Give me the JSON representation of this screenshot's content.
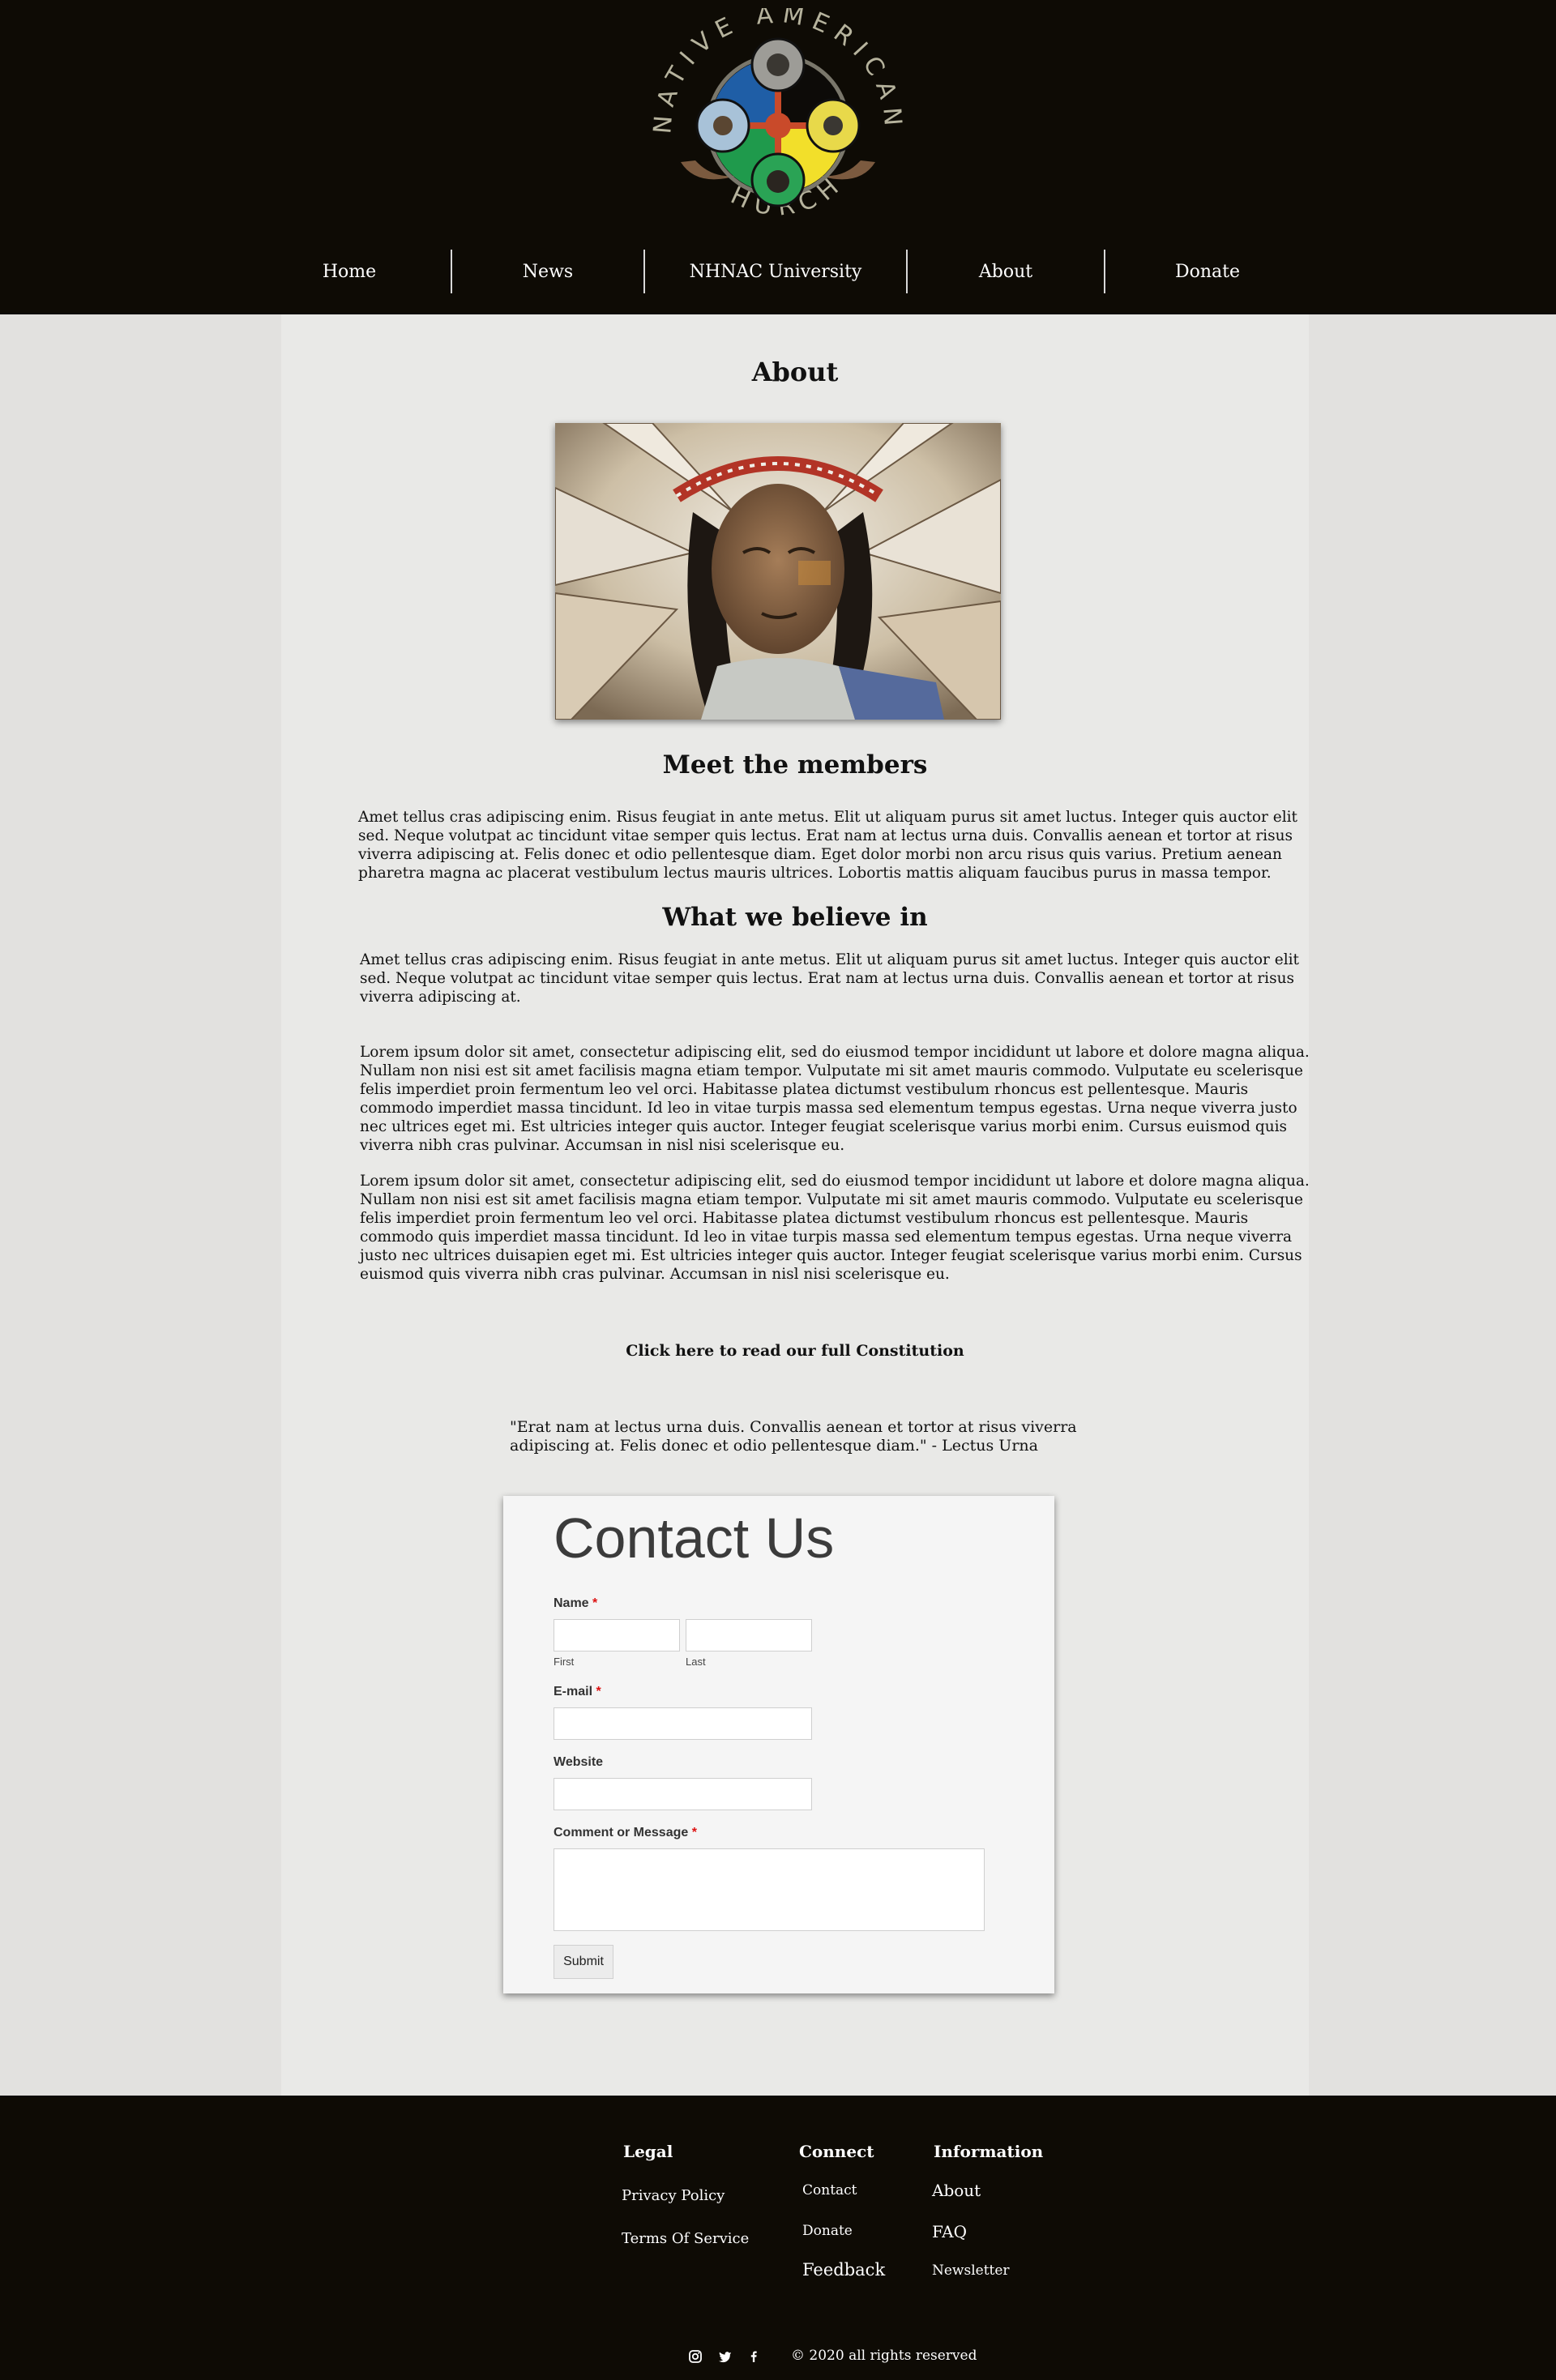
{
  "logo": {
    "top_text": "NATIVE AMERICAN",
    "bottom_text": "CHURCH"
  },
  "nav": {
    "items": [
      "Home",
      "News",
      "NHNAC University",
      "About",
      "Donate"
    ]
  },
  "page": {
    "title": "About",
    "photo_alt": "Native American man wearing a feathered headdress"
  },
  "members": {
    "heading": "Meet the members",
    "text": "Amet tellus cras adipiscing enim. Risus feugiat in ante metus. Elit ut aliquam purus sit amet luctus. Integer quis auctor elit sed. Neque volutpat ac tincidunt vitae semper quis lectus. Erat nam at lectus urna duis. Convallis aenean et tortor at risus viverra adipiscing at. Felis donec et odio pellentesque diam. Eget dolor morbi non arcu risus quis varius. Pretium aenean pharetra magna ac placerat vestibulum lectus mauris ultrices. Lobortis mattis aliquam faucibus purus in massa tempor."
  },
  "beliefs": {
    "heading": "What we believe in",
    "p1": "Amet tellus cras adipiscing enim. Risus feugiat in ante metus. Elit ut aliquam purus sit amet luctus. Integer quis auctor elit sed. Neque volutpat ac tincidunt vitae semper quis lectus. Erat nam at lectus urna duis. Convallis aenean et tortor at risus viverra adipiscing at.",
    "p2": "Lorem ipsum dolor sit amet, consectetur adipiscing elit, sed do eiusmod tempor incididunt ut labore et dolore magna aliqua. Nullam non nisi est sit amet facilisis magna etiam tempor. Vulputate mi sit amet mauris commodo. Vulputate eu scelerisque felis imperdiet proin fermentum leo vel orci. Habitasse platea dictumst vestibulum rhoncus est pellentesque. Mauris commodo imperdiet massa tincidunt. Id leo in vitae turpis massa sed elementum tempus egestas. Urna neque viverra justo nec ultrices eget mi. Est ultricies integer quis auctor. Integer feugiat scelerisque varius morbi enim. Cursus euismod quis viverra nibh cras pulvinar. Accumsan in nisl nisi scelerisque eu.",
    "p3": "Lorem ipsum dolor sit amet, consectetur adipiscing elit, sed do eiusmod tempor incididunt ut labore et dolore magna aliqua. Nullam non nisi est sit amet facilisis magna etiam tempor. Vulputate mi sit amet mauris commodo. Vulputate eu scelerisque felis imperdiet proin fermentum leo vel orci. Habitasse platea dictumst vestibulum rhoncus est pellentesque. Mauris commodo quis imperdiet massa tincidunt. Id leo in vitae turpis massa sed elementum tempus egestas. Urna neque viverra justo nec ultrices duisapien eget mi. Est ultricies integer quis auctor. Integer feugiat scelerisque varius morbi enim. Cursus euismod quis viverra nibh cras pulvinar. Accumsan in nisl nisi scelerisque eu."
  },
  "constitution_link": "Click here to read our full Constitution",
  "quote": "\"Erat nam at lectus urna duis. Convallis aenean et tortor at risus viverra adipiscing at. Felis donec et odio pellentesque diam.\" - Lectus Urna",
  "contact_form": {
    "title": "Contact Us",
    "name_label": "Name",
    "required_mark": "*",
    "first_label": "First",
    "last_label": "Last",
    "first_value": "",
    "last_value": "",
    "email_label": "E-mail",
    "email_value": "",
    "website_label": "Website",
    "website_value": "",
    "message_label": "Comment or Message",
    "message_value": "",
    "submit_label": "Submit"
  },
  "footer": {
    "legal": {
      "heading": "Legal",
      "links": [
        "Privacy Policy",
        "Terms Of Service"
      ]
    },
    "connect": {
      "heading": "Connect",
      "links": [
        "Contact",
        "Donate",
        "Feedback"
      ]
    },
    "information": {
      "heading": "Information",
      "links": [
        "About",
        "FAQ",
        "Newsletter"
      ]
    },
    "social_icons": [
      "instagram-icon",
      "twitter-icon",
      "facebook-icon"
    ],
    "copyright": "© 2020 all rights reserved"
  },
  "colors": {
    "header_bg": "#0e0b05",
    "panel_bg": "#e9e9e7",
    "page_bg": "#e2e1df",
    "required": "#dd1111"
  }
}
